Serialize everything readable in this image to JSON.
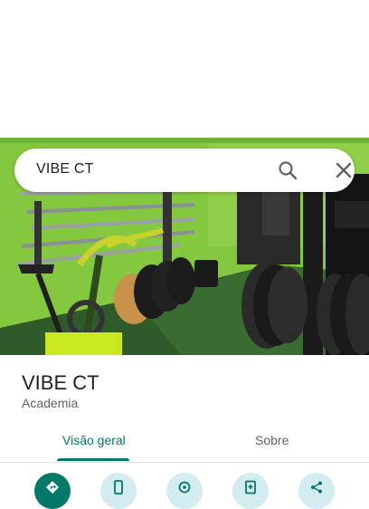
{
  "search": {
    "query": "VIBE CT"
  },
  "icons": {
    "search": "search-icon",
    "close": "close-icon",
    "directions": "directions-icon",
    "phone": "phone-icon",
    "location": "location-icon",
    "save": "save-icon",
    "share": "share-icon"
  },
  "place": {
    "title": "VIBE CT",
    "category": "Academia"
  },
  "tabs": [
    {
      "label": "Visão geral",
      "selected": true
    },
    {
      "label": "Sobre",
      "selected": false
    }
  ],
  "colors": {
    "accent": "#00796b",
    "action_bg": "#d3ecf0",
    "wall": "#7ec43c"
  }
}
